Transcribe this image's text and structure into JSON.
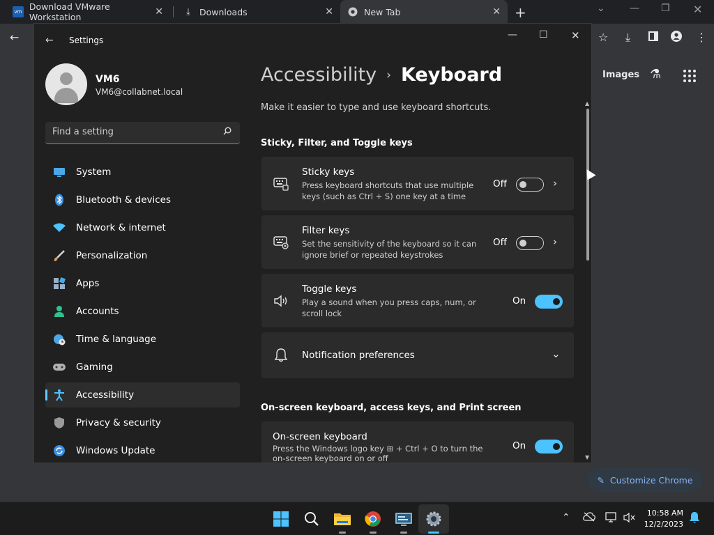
{
  "browser": {
    "tabs": [
      {
        "title": "Download VMware Workstation",
        "favicon": "vmware-icon"
      },
      {
        "title": "Downloads",
        "favicon": "download-icon"
      },
      {
        "title": "New Tab",
        "favicon": "chrome-icon"
      }
    ],
    "page": {
      "images_link": "Images",
      "customize_button": "Customize Chrome"
    }
  },
  "settings": {
    "window_title": "Settings",
    "profile": {
      "name": "VM6",
      "email": "VM6@collabnet.local"
    },
    "search_placeholder": "Find a setting",
    "nav": [
      {
        "label": "System",
        "icon": "monitor-icon",
        "color": "#4aa8e8"
      },
      {
        "label": "Bluetooth & devices",
        "icon": "bluetooth-icon",
        "color": "#3b8ee0"
      },
      {
        "label": "Network & internet",
        "icon": "wifi-icon",
        "color": "#4cc2ff"
      },
      {
        "label": "Personalization",
        "icon": "brush-icon",
        "color": "#e0a060"
      },
      {
        "label": "Apps",
        "icon": "apps-icon",
        "color": "#9ab0c8"
      },
      {
        "label": "Accounts",
        "icon": "person-icon",
        "color": "#2fc18f"
      },
      {
        "label": "Time & language",
        "icon": "globe-clock-icon",
        "color": "#4aa8e8"
      },
      {
        "label": "Gaming",
        "icon": "gamepad-icon",
        "color": "#b0b0b0"
      },
      {
        "label": "Accessibility",
        "icon": "accessibility-icon",
        "color": "#4cc2ff"
      },
      {
        "label": "Privacy & security",
        "icon": "shield-icon",
        "color": "#9a9a9a"
      },
      {
        "label": "Windows Update",
        "icon": "update-icon",
        "color": "#3b8ee0"
      }
    ],
    "selected_nav": "Accessibility",
    "breadcrumb": {
      "parent": "Accessibility",
      "current": "Keyboard"
    },
    "subtitle": "Make it easier to type and use keyboard shortcuts.",
    "sections": [
      {
        "title": "Sticky, Filter, and Toggle keys"
      },
      {
        "title": "On-screen keyboard, access keys, and Print screen"
      }
    ],
    "cards": {
      "sticky": {
        "title": "Sticky keys",
        "desc": "Press keyboard shortcuts that use multiple keys (such as Ctrl + S) one key at a time",
        "state": "Off",
        "icon": "keyboard-sticky-icon"
      },
      "filter": {
        "title": "Filter keys",
        "desc": "Set the sensitivity of the keyboard so it can ignore brief or repeated keystrokes",
        "state": "Off",
        "icon": "keyboard-filter-icon"
      },
      "toggle": {
        "title": "Toggle keys",
        "desc": "Play a sound when you press caps, num, or scroll lock",
        "state": "On",
        "icon": "speaker-icon"
      },
      "notify": {
        "title": "Notification preferences",
        "icon": "bell-icon"
      },
      "osk": {
        "title": "On-screen keyboard",
        "desc_before": "Press the Windows logo key",
        "desc_after": "+ Ctrl + O to turn the on-screen keyboard on or off",
        "state": "On"
      }
    }
  },
  "taskbar": {
    "apps": [
      "windows-start-icon",
      "search-icon",
      "file-explorer-icon",
      "chrome-icon",
      "remote-desktop-icon",
      "settings-gear-icon"
    ],
    "clock": {
      "time": "10:58 AM",
      "date": "12/2/2023"
    }
  },
  "colors": {
    "accent": "#4cc2ff",
    "card_bg": "#2b2b2b",
    "window_bg": "#202020"
  }
}
